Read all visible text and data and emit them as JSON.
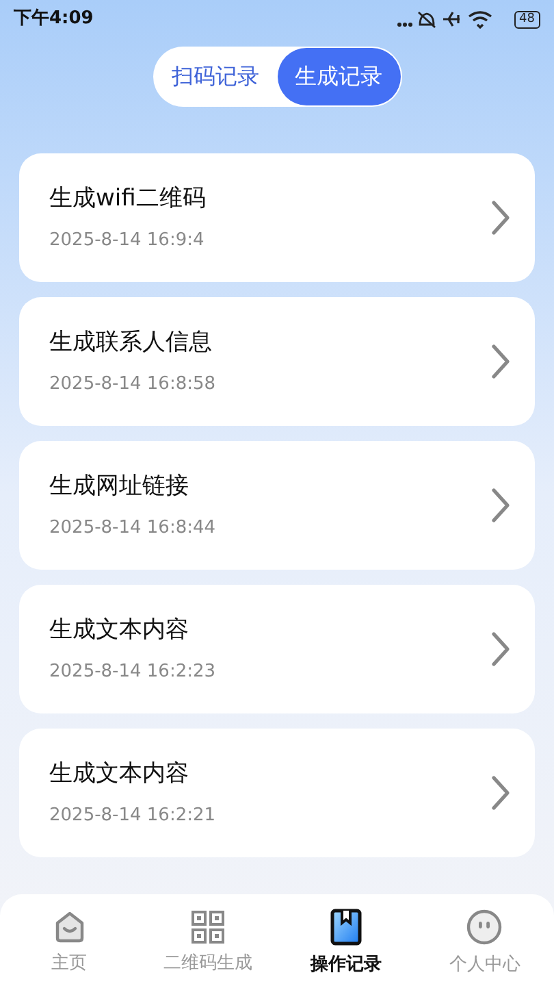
{
  "status_bar": {
    "time": "下午4:09",
    "battery": "48"
  },
  "tabs": [
    {
      "label": "扫码记录",
      "selected": false
    },
    {
      "label": "生成记录",
      "selected": true
    }
  ],
  "records": [
    {
      "title": "生成wifi二维码",
      "time": "2025-8-14 16:9:4"
    },
    {
      "title": "生成联系人信息",
      "time": "2025-8-14 16:8:58"
    },
    {
      "title": "生成网址链接",
      "time": "2025-8-14 16:8:44"
    },
    {
      "title": "生成文本内容",
      "time": "2025-8-14 16:2:23"
    },
    {
      "title": "生成文本内容",
      "time": "2025-8-14 16:2:21"
    }
  ],
  "nav": [
    {
      "kind": "home",
      "label": "主页",
      "selected": false
    },
    {
      "kind": "qr",
      "label": "二维码生成",
      "selected": false
    },
    {
      "kind": "records",
      "label": "操作记录",
      "selected": true
    },
    {
      "kind": "profile",
      "label": "个人中心",
      "selected": false
    }
  ]
}
